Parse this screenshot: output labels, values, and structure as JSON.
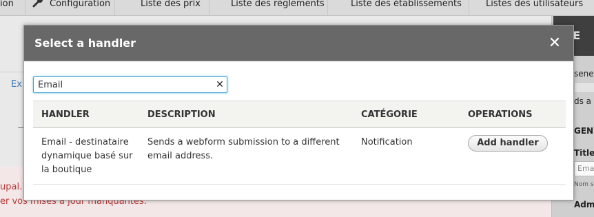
{
  "toolbar": {
    "items": [
      "ion",
      "Configuration",
      "Liste des prix",
      "Liste des règlements",
      "Liste des établissements",
      "Listes des utilisateurs"
    ]
  },
  "background": {
    "link_text": "Ex",
    "error_line1": "upal. A",
    "error_line2": "er vos mises à jour manquantes.",
    "right_panel": {
      "header": "lit E",
      "label_gener": "sener",
      "label_ds": "ds a",
      "label_gen": "GEN",
      "label_title": "Title",
      "field_value": "Ema",
      "small_text": "Nom s",
      "label_adm": "Adm"
    }
  },
  "dialog": {
    "title": "Select a handler",
    "close_glyph": "✕",
    "search": {
      "value": "Email",
      "clear_glyph": "✕"
    },
    "columns": [
      "HANDLER",
      "DESCRIPTION",
      "CATÉGORIE",
      "OPERATIONS"
    ],
    "rows": [
      {
        "handler": "Email - destinataire dynamique basé sur la boutique",
        "description": "Sends a webform submission to a different email address.",
        "category": "Notification",
        "operation_label": "Add handler"
      }
    ]
  }
}
